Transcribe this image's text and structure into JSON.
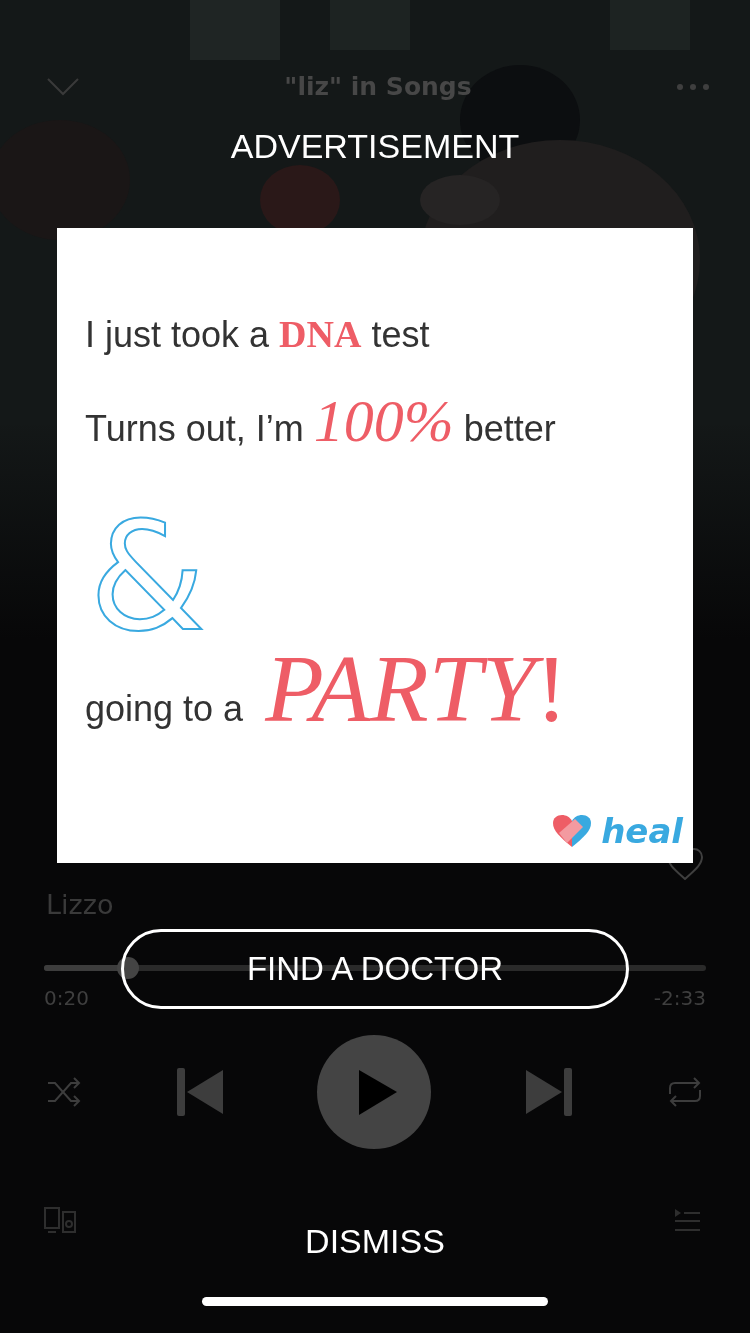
{
  "player": {
    "header_title": "\"liz\" in Songs",
    "artist": "Lizzo",
    "liked": false,
    "progress": {
      "level": 0.127
    },
    "elapsed": "0:20",
    "remaining": "-2:33"
  },
  "ad": {
    "label": "ADVERTISEMENT",
    "blocks": [
      {
        "kind": "sentence",
        "segments": [
          {
            "text": "I just took a ",
            "kind": "plain"
          },
          {
            "text": "DNA",
            "kind": "serif-bold"
          },
          {
            "text": " test",
            "kind": "plain"
          }
        ]
      },
      {
        "kind": "sentence",
        "segments": [
          {
            "text": "Turns out, I’m ",
            "kind": "plain"
          },
          {
            "text": "100%",
            "kind": "serif-italic"
          },
          {
            "text": " better",
            "kind": "plain"
          }
        ]
      },
      {
        "kind": "glyph",
        "text": "&"
      },
      {
        "kind": "sentence",
        "segments": [
          {
            "text": "going to a ",
            "kind": "plain"
          },
          {
            "text": "PARTY",
            "kind": "serif-italic-big"
          },
          {
            "text": "!",
            "kind": "serif-big"
          }
        ]
      }
    ],
    "brand": "heal",
    "cta": "FIND A DOCTOR",
    "dismiss": "DISMISS"
  }
}
